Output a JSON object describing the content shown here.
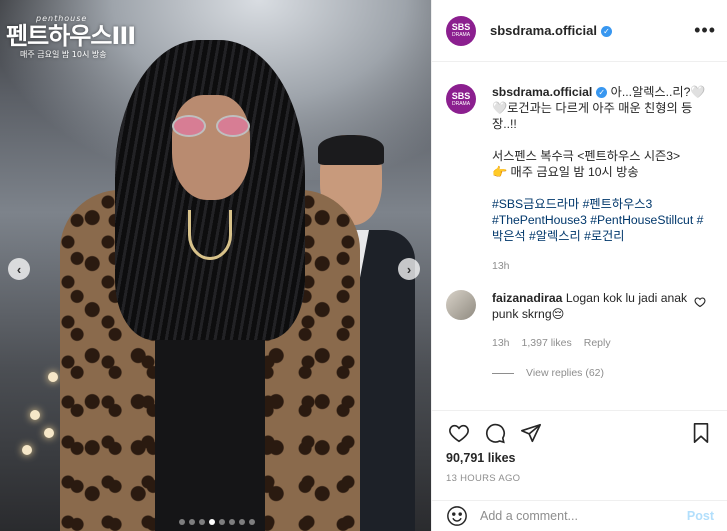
{
  "photo": {
    "watermark_small": "penthouse",
    "watermark_title": "펜트하우스III",
    "watermark_schedule": "매주 금요일 밤 10시 방송",
    "slide_count": 8,
    "active_slide": 3
  },
  "account": {
    "username": "sbsdrama.official",
    "avatar_line1": "SBS",
    "avatar_line2": "DRAMA",
    "verified": true
  },
  "caption": {
    "username": "sbsdrama.official",
    "line1": "아...알렉스..리?🤍🤍로건과는 다르게 아주 매운 친형의 등장..!!",
    "line2": "서스펜스 복수극 <펜트하우스 시즌3>",
    "line3": "👉 매주 금요일 밤 10시 방송",
    "hashtags": [
      "#SBS금요드라마",
      "#펜트하우스3",
      "#ThePentHouse3",
      "#PentHouseStillcut",
      "#박은석",
      "#알렉스리",
      "#로건리"
    ],
    "time": "13h"
  },
  "comment": {
    "username": "faizanadiraa",
    "text": "Logan kok lu jadi anak punk skrng😔",
    "time": "13h",
    "likes": "1,397 likes",
    "reply": "Reply",
    "view_replies": "View replies (62)"
  },
  "post": {
    "likes": "90,791 likes",
    "ago": "13 HOURS AGO"
  },
  "add_comment": {
    "placeholder": "Add a comment...",
    "post_label": "Post"
  },
  "colors": {
    "brand_avatar": "#8b1f8f",
    "hashtag": "#00376b",
    "verified": "#3897f0",
    "muted": "#8e8e8e"
  }
}
